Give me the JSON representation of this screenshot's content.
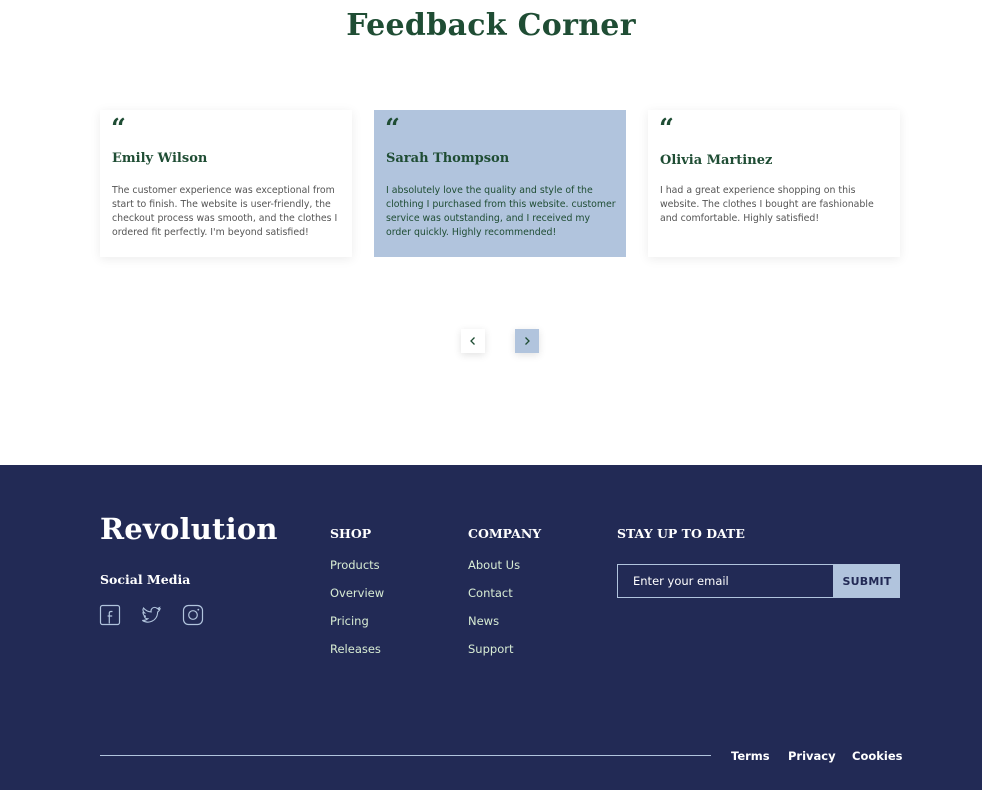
{
  "testimonials": {
    "title": "Feedback Corner",
    "quote_glyph": "“",
    "items": [
      {
        "name": "Emily Wilson",
        "text": "The customer experience was exceptional from start to finish. The website is user-friendly, the checkout process was smooth, and the clothes I ordered fit perfectly. I'm beyond satisfied!"
      },
      {
        "name": "Sarah Thompson",
        "text": "I absolutely love the quality and style of the clothing I purchased from this website. customer service was outstanding, and I received my order quickly. Highly recommended!"
      },
      {
        "name": "Olivia Martinez",
        "text": "I had a great experience shopping on this website. The clothes I bought are fashionable and comfortable. Highly satisfied!"
      }
    ]
  },
  "footer": {
    "brand": "Revolution",
    "social_title": "Social Media",
    "social_icons": [
      "facebook-icon",
      "twitter-icon",
      "instagram-icon"
    ],
    "shop": {
      "title": "SHOP",
      "links": [
        "Products",
        "Overview",
        "Pricing",
        "Releases"
      ]
    },
    "company": {
      "title": "COMPANY",
      "links": [
        "About Us",
        "Contact",
        "News",
        "Support"
      ]
    },
    "newsletter": {
      "title": "STAY UP TO DATE",
      "placeholder": "Enter your email",
      "submit_label": "SUBMIT"
    },
    "legal": [
      "Terms",
      "Privacy",
      "Cookies"
    ]
  },
  "colors": {
    "primary_green": "#1f4d34",
    "accent_blue": "#b1c4dd",
    "footer_bg": "#222a55"
  }
}
